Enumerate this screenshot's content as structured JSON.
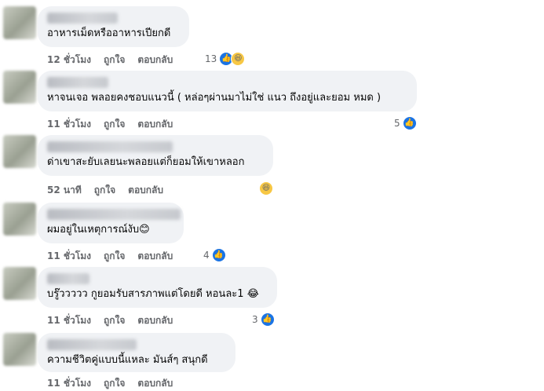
{
  "comments": [
    {
      "text": "อาหารเม็ดหรืออาหารเปียกดี",
      "time": "12 ชั่วโมง",
      "like": "ถูกใจ",
      "reply": "ตอบกลับ",
      "react_count": "13",
      "reactions": [
        "like",
        "haha"
      ]
    },
    {
      "text": "หาจนเจอ พลอยคงชอบแนวนี้ ( หล่อๆผ่านมาไม่ใช่ แนว ถึงอยู่และยอม หมด )",
      "time": "11 ชั่วโมง",
      "like": "ถูกใจ",
      "reply": "ตอบกลับ",
      "react_count": "5",
      "reactions": [
        "like"
      ]
    },
    {
      "text": "ด่าเขาสะยับเลยนะพลอยแต่ก็ยอมให้เขาหลอก",
      "time": "52 นาที",
      "like": "ถูกใจ",
      "reply": "ตอบกลับ",
      "react_count": "",
      "reactions": [
        "haha"
      ]
    },
    {
      "text": "ผมอยู่ในเหตุการณ์งับ",
      "emoji": "😊",
      "time": "11 ชั่วโมง",
      "like": "ถูกใจ",
      "reply": "ตอบกลับ",
      "react_count": "4",
      "reactions": [
        "like"
      ]
    },
    {
      "text": "บรู๊ววววว กูยอมรับสารภาพแต่โดยดี หอนละ1",
      "emoji": "😂",
      "time": "11 ชั่วโมง",
      "like": "ถูกใจ",
      "reply": "ตอบกลับ",
      "react_count": "3",
      "reactions": [
        "like"
      ]
    },
    {
      "text": "ความชีวิตคู่แบบนี้แหละ มันส์ๆ สนุกดี",
      "time": "11 ชั่วโมง",
      "like": "ถูกใจ",
      "reply": "ตอบกลับ",
      "react_count": "",
      "reactions": []
    }
  ],
  "icons": {
    "like": "thumbs-up-icon",
    "haha": "laughing-face-icon"
  },
  "colors": {
    "like_blue": "#1b74e4",
    "bubble": "#f0f2f5",
    "meta": "#65676b"
  }
}
